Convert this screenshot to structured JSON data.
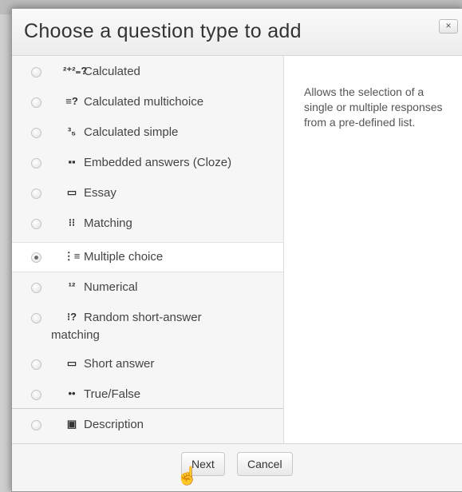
{
  "dialog": {
    "title": "Choose a question type to add",
    "close_label": "×",
    "summary": "Allows the selection of a single or multiple responses from a pre-defined list."
  },
  "options": [
    {
      "label": "Calculated",
      "icon": "calculated-icon",
      "glyph": "²⁺²₌?",
      "checked": false
    },
    {
      "label": "Calculated multichoice",
      "icon": "calculated-multichoice-icon",
      "glyph": "≡?",
      "checked": false
    },
    {
      "label": "Calculated simple",
      "icon": "calculated-simple-icon",
      "glyph": "³₅",
      "checked": false
    },
    {
      "label": "Embedded answers (Cloze)",
      "icon": "cloze-icon",
      "glyph": "▪▪",
      "checked": false
    },
    {
      "label": "Essay",
      "icon": "essay-icon",
      "glyph": "▭",
      "checked": false
    },
    {
      "label": "Matching",
      "icon": "matching-icon",
      "glyph": "⁝⁝",
      "checked": false
    },
    {
      "label": "Multiple choice",
      "icon": "multiple-choice-icon",
      "glyph": "⋮≡",
      "checked": true
    },
    {
      "label": "Numerical",
      "icon": "numerical-icon",
      "glyph": "¹²",
      "checked": false
    },
    {
      "label": "Random short-answer matching",
      "label_line1": "Random short-answer",
      "label_line2": "matching",
      "icon": "random-short-answer-icon",
      "glyph": "⁝?",
      "checked": false
    },
    {
      "label": "Short answer",
      "icon": "short-answer-icon",
      "glyph": "▭",
      "checked": false
    },
    {
      "label": "True/False",
      "icon": "true-false-icon",
      "glyph": "••",
      "checked": false
    },
    {
      "label": "Description",
      "icon": "description-icon",
      "glyph": "▣",
      "checked": false
    }
  ],
  "buttons": {
    "next": "Next",
    "cancel": "Cancel"
  }
}
